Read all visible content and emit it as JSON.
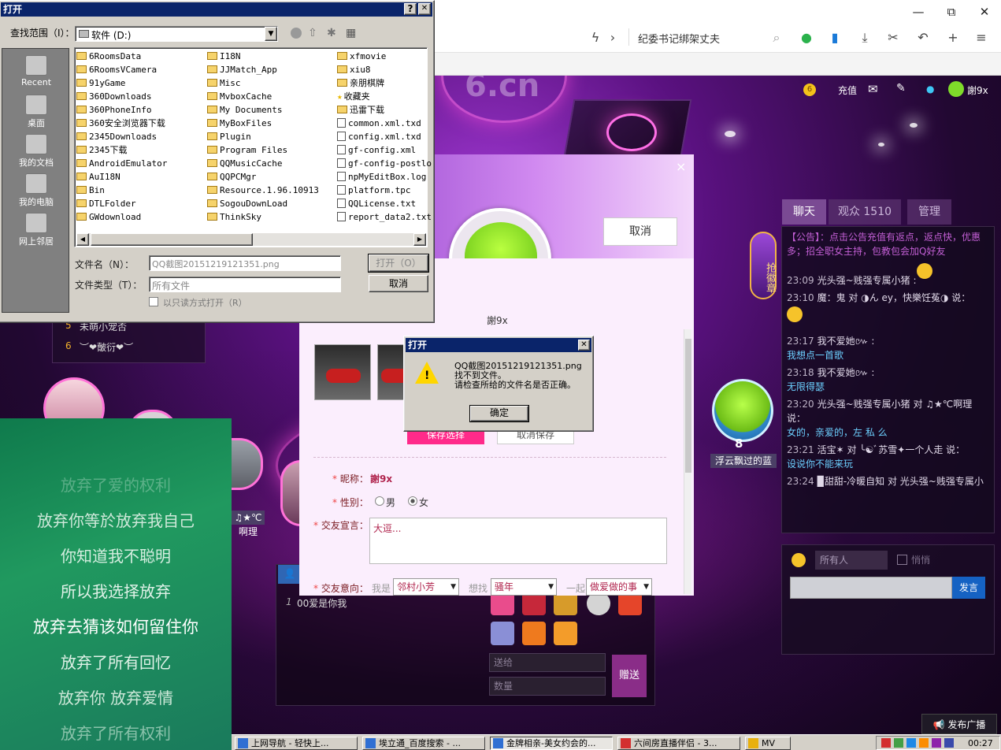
{
  "browser": {
    "window_controls": {
      "minimize": "—",
      "restore": "⧉",
      "close": "✕"
    },
    "search_text": "纪委书记绑架丈夫",
    "toolbar_icons": [
      "lightning-icon",
      "chevron-right-icon",
      "search-icon",
      "chat-icon",
      "phone-icon",
      "download-icon",
      "scissors-icon",
      "undo-icon",
      "plus-icon",
      "menu-icon"
    ]
  },
  "site": {
    "logo_text": "6.cn",
    "top": {
      "coin": "6",
      "recharge": "充值",
      "username": "謝9x"
    },
    "chat_tabs": [
      "聊天",
      "观众 1510",
      "管理"
    ],
    "badge_label": "抢徽章",
    "chat_messages": [
      {
        "time": "",
        "text": "【公告】：点击公告充值有返点，返点快，优惠多；招全职女主持，包教包会加Q好友",
        "msg": "",
        "notice": true
      },
      {
        "time": "23:09",
        "text": "光头强~贱强专属小猪 :",
        "msg": "",
        "emoji": true
      },
      {
        "time": "23:10",
        "text": "魔：鬼 对 ◑ん ey，快樂饪菟◑ 说：",
        "msg": "",
        "emoji": true
      },
      {
        "time": "23:17",
        "text": "我不爱她៚ :",
        "msg": "我想点一首歌"
      },
      {
        "time": "23:18",
        "text": "我不爱她៚ :",
        "msg": "无限得瑟"
      },
      {
        "time": "23:20",
        "text": "光头强~贱强专属小猪 对 ♫★℃啊理 说：",
        "msg": "女的，亲爱的，左 私 么"
      },
      {
        "time": "23:21",
        "text": "活宝✶ 对 ╰☯ﾞ苏雪✦一个人走 说：",
        "msg": "设说你不能来玩"
      },
      {
        "time": "23:24",
        "text": "▉甜甜-冷暖自知 对 光头强~贱强专属小",
        "msg": ""
      }
    ],
    "chat_input": {
      "target": "所有人",
      "whisper": "悄悄",
      "send": "发言"
    },
    "broadcast": "发布广播",
    "rank": [
      {
        "num": "5",
        "name": "未萌小宠否"
      },
      {
        "num": "6",
        "name": "︶❤皾衍❤︶"
      }
    ],
    "avatar_labels": {
      "left": "♫★℃啊理",
      "right": "浮云飘过的蓝",
      "right_num": "8"
    },
    "gift": {
      "chat_input_line": "00爱是你我",
      "line_num": "1",
      "send_to": "送给",
      "quantity": "数量",
      "gift_button": "赠送"
    }
  },
  "lyrics": {
    "lines": [
      "放弃了爱的权利",
      "放弃你等於放弃我自己",
      "你知道我不聪明",
      "所以我选择放弃",
      "放弃去猜该如何留住你",
      "放弃了所有回忆",
      "放弃你  放弃爱情",
      "放弃了所有权利"
    ]
  },
  "profile": {
    "close": "×",
    "cancel": "取消",
    "username": "謝9x",
    "save_buttons": [
      "保存选择",
      "取消保存"
    ],
    "nickname_label": "昵称：",
    "nickname_value": "謝9x",
    "gender_label": "性别：",
    "gender_options": [
      "男",
      "女"
    ],
    "gender_selected": "女",
    "motto_label": "交友宣言：",
    "motto_value": "大逗...",
    "intent_label": "交友意向：",
    "i_am": "我是",
    "i_am_value": "邻村小芳",
    "looking": "想找",
    "looking_value": "骚年",
    "together": "一起",
    "together_value": "做爱做的事"
  },
  "file_dialog": {
    "title": "打开",
    "help": "?",
    "close": "✕",
    "lookin_label": "查找范围（I）：",
    "lookin_value": "软件  (D:)",
    "sidebar": [
      "Recent",
      "桌面",
      "我的文档",
      "我的电脑",
      "网上邻居"
    ],
    "columns": [
      [
        "6RoomsData",
        "6RoomsVCamera",
        "91yGame",
        "360Downloads",
        "360PhoneInfo",
        "360安全浏览器下载",
        "2345Downloads",
        "2345下载",
        "AndroidEmulator",
        "AuI18N",
        "Bin",
        "DTLFolder",
        "GWdownload"
      ],
      [
        "I18N",
        "JJMatch_App",
        "Misc",
        "MvboxCache",
        "My Documents",
        "MyBoxFiles",
        "Plugin",
        "Program Files",
        "QQMusicCache",
        "QQPCMgr",
        "Resource.1.96.10913",
        "SogouDownLoad",
        "ThinkSky"
      ],
      [
        "xfmovie",
        "xiu8",
        "亲朋棋牌",
        "收藏夹",
        "迅雷下载",
        "common.xml.txd",
        "config.xml.txd",
        "gf-config.xml",
        "gf-config-postlo",
        "npMyEditBox.log",
        "platform.tpc",
        "QQLicense.txt",
        "report_data2.txt"
      ]
    ],
    "col3_types": [
      "folder",
      "folder",
      "folder",
      "star",
      "folder",
      "file",
      "file",
      "file",
      "file",
      "file",
      "file",
      "file",
      "file"
    ],
    "filename_label": "文件名（N）：",
    "filename_value": "QQ截图20151219121351.png",
    "filetype_label": "文件类型（T）：",
    "filetype_value": "所有文件",
    "readonly_label": "以只读方式打开（R）",
    "open_button": "打开（O）",
    "cancel_button": "取消"
  },
  "error_dialog": {
    "title": "打开",
    "close": "✕",
    "line1": "QQ截图20151219121351.png",
    "line2": "找不到文件。",
    "line3": "请检查所给的文件名是否正确。",
    "ok": "确定"
  },
  "taskbar": {
    "tasks": [
      "上网导航 - 轻快上...",
      "埃立通_百度搜索 - ...",
      "金牌相亲-美女约会的...",
      "六间房直播伴侣 - 3...",
      "MV"
    ],
    "clock": "00:27"
  }
}
